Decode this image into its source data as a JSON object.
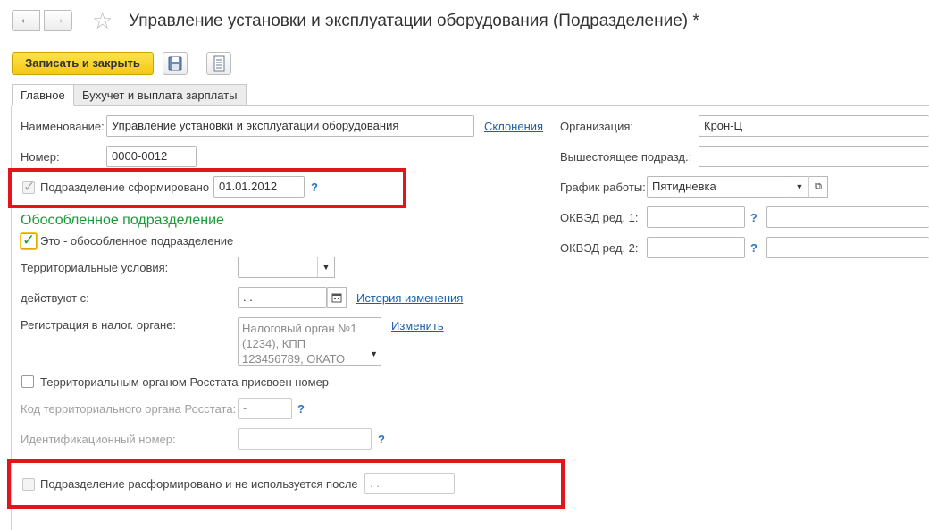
{
  "window": {
    "title": "Управление установки и эксплуатации оборудования (Подразделение) *"
  },
  "toolbar": {
    "save_close_label": "Записать и закрыть"
  },
  "tabs": [
    {
      "label": "Главное",
      "active": true
    },
    {
      "label": "Бухучет и выплата зарплаты",
      "active": false
    }
  ],
  "form": {
    "name_label": "Наименование:",
    "name_value": "Управление установки и эксплуатации оборудования",
    "declensions_link": "Склонения",
    "number_label": "Номер:",
    "number_value": "0000-0012",
    "formed_label": "Подразделение сформировано",
    "formed_checked": true,
    "formed_date": "01.01.2012",
    "help": "?",
    "separate_section_title": "Обособленное подразделение",
    "separate_checkbox_label": "Это - обособленное подразделение",
    "separate_checked": true,
    "territorial_label": "Территориальные условия:",
    "territorial_value": "",
    "effective_from_label": "действуют с:",
    "effective_from_value": " .  .",
    "history_link": "История изменения",
    "tax_reg_label": "Регистрация в налог. органе:",
    "tax_reg_value": "Налоговый орган №1 (1234), КПП 123456789, ОКАТО",
    "change_link": "Изменить",
    "rosstat_checkbox_label": "Территориальным органом Росстата присвоен номер",
    "rosstat_checked": false,
    "rosstat_code_label": "Код территориального органа Росстата:",
    "rosstat_code_value": "-",
    "id_number_label": "Идентификационный номер:",
    "id_number_value": "",
    "disbanded_label": "Подразделение расформировано и не используется после",
    "disbanded_checked": false,
    "disbanded_date": " .  ."
  },
  "right": {
    "org_label": "Организация:",
    "org_value": "Крон-Ц",
    "parent_label": "Вышестоящее подразд.:",
    "parent_value": "",
    "schedule_label": "График работы:",
    "schedule_value": "Пятидневка",
    "okved1_label": "ОКВЭД ред. 1:",
    "okved1_value": "",
    "okved2_label": "ОКВЭД ред. 2:",
    "okved2_value": ""
  },
  "colors": {
    "accent_button": "#f4c713",
    "section_title": "#1a9b3a",
    "link": "#1a5fa8",
    "highlight": "#e2141c"
  }
}
